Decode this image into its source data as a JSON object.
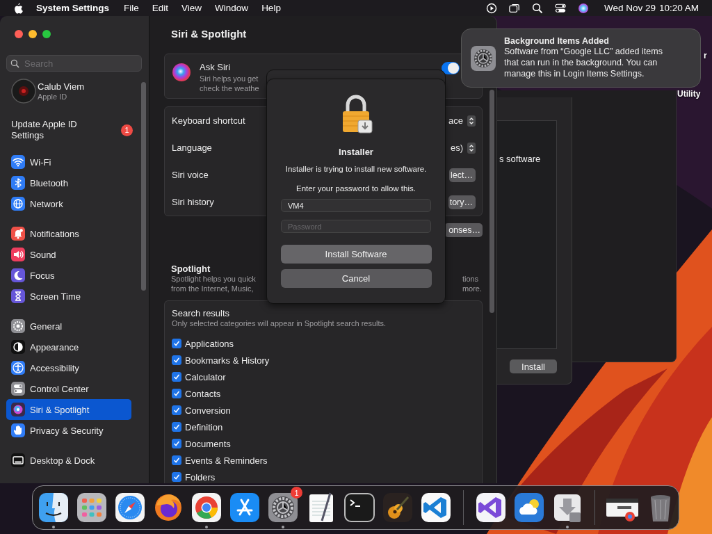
{
  "menu_bar": {
    "app_name": "System Settings",
    "menus": [
      "File",
      "Edit",
      "View",
      "Window",
      "Help"
    ],
    "date": "Wed Nov 29",
    "time": "10:20 AM"
  },
  "settings_window": {
    "sidebar": {
      "search": {
        "placeholder": "Search"
      },
      "account": {
        "name": "Calub Viem",
        "subtitle": "Apple ID"
      },
      "update": {
        "label": "Update Apple ID Settings",
        "badge": "1"
      },
      "groups": [
        [
          {
            "label": "Wi-Fi",
            "kind": "wifi",
            "color": "#2f7cf6",
            "selected": false
          },
          {
            "label": "Bluetooth",
            "kind": "bluetooth",
            "color": "#2f7cf6",
            "selected": false
          },
          {
            "label": "Network",
            "kind": "network",
            "color": "#2f7cf6",
            "selected": false
          }
        ],
        [
          {
            "label": "Notifications",
            "kind": "notifications",
            "color": "#ef5148",
            "selected": false
          },
          {
            "label": "Sound",
            "kind": "sound",
            "color": "#ee3e5e",
            "selected": false
          },
          {
            "label": "Focus",
            "kind": "focus",
            "color": "#6656d8",
            "selected": false
          },
          {
            "label": "Screen Time",
            "kind": "screen_time",
            "color": "#6656d8",
            "selected": false
          }
        ],
        [
          {
            "label": "General",
            "kind": "general",
            "color": "#8e8e93",
            "selected": false
          },
          {
            "label": "Appearance",
            "kind": "appearance",
            "color": "#111111",
            "selected": false
          },
          {
            "label": "Accessibility",
            "kind": "accessibility",
            "color": "#2f7cf6",
            "selected": false
          },
          {
            "label": "Control Center",
            "kind": "control_center",
            "color": "#8e8e93",
            "selected": false
          },
          {
            "label": "Siri & Spotlight",
            "kind": "siri",
            "color": "#3a2a4a",
            "selected": true
          },
          {
            "label": "Privacy & Security",
            "kind": "privacy",
            "color": "#2f7cf6",
            "selected": false
          }
        ],
        [
          {
            "label": "Desktop & Dock",
            "kind": "desktop",
            "color": "#111111",
            "selected": false
          }
        ]
      ]
    },
    "title": "Siri & Spotlight",
    "ask_siri": {
      "title": "Ask Siri",
      "description_lines": [
        "Siri helps you get",
        "check the weathe"
      ],
      "on": true
    },
    "rows": [
      {
        "label": "Keyboard shortcut",
        "kind": "popup",
        "value": "ace"
      },
      {
        "label": "Language",
        "kind": "popup",
        "value": "es)"
      },
      {
        "label": "Siri voice",
        "kind": "button",
        "value": "lect…"
      },
      {
        "label": "Siri history",
        "kind": "button",
        "value": "tory…"
      }
    ],
    "responses_button": "onses…",
    "spotlight": {
      "title": "Spotlight",
      "description_left": [
        "Spotlight helps you quick",
        "from the Internet, Music,"
      ],
      "description_right": [
        "tions",
        "more."
      ]
    },
    "search_results": {
      "title": "Search results",
      "description": "Only selected categories will appear in Spotlight search results.",
      "categories": [
        {
          "label": "Applications",
          "checked": true
        },
        {
          "label": "Bookmarks & History",
          "checked": true
        },
        {
          "label": "Calculator",
          "checked": true
        },
        {
          "label": "Contacts",
          "checked": true
        },
        {
          "label": "Conversion",
          "checked": true
        },
        {
          "label": "Definition",
          "checked": true
        },
        {
          "label": "Documents",
          "checked": true
        },
        {
          "label": "Events & Reminders",
          "checked": true
        },
        {
          "label": "Folders",
          "checked": true
        }
      ]
    }
  },
  "installer_dialog": {
    "title": "Installer",
    "message": "Installer is trying to install new software.",
    "prompt": "Enter your password to allow this.",
    "username": "VM4",
    "password_placeholder": "Password",
    "buttons": [
      {
        "label": "Install Software",
        "kind": "default"
      },
      {
        "label": "Cancel",
        "kind": "cancel"
      }
    ]
  },
  "installer_window": {
    "text": "s software",
    "button": "Install"
  },
  "desktop_label": [
    "r",
    "Utility"
  ],
  "notification": {
    "title": "Background Items Added",
    "body": "Software from “Google LLC” added items that can run in the background. You can manage this in Login Items Settings."
  },
  "dock": {
    "sections": [
      [
        {
          "kind": "finder",
          "running": true
        },
        {
          "kind": "launchpad",
          "running": false
        },
        {
          "kind": "safari",
          "running": false
        },
        {
          "kind": "firefox",
          "running": false
        },
        {
          "kind": "chrome",
          "running": true
        },
        {
          "kind": "app_store",
          "running": false
        },
        {
          "kind": "settings",
          "running": true,
          "badge": "1"
        },
        {
          "kind": "textedit",
          "running": false
        },
        {
          "kind": "terminal",
          "running": false
        },
        {
          "kind": "garageband",
          "running": false
        },
        {
          "kind": "vscode",
          "running": false
        }
      ],
      [
        {
          "kind": "visual_studio",
          "running": false
        },
        {
          "kind": "weather",
          "running": false
        },
        {
          "kind": "installer",
          "running": true
        }
      ],
      [
        {
          "kind": "window",
          "running": false
        },
        {
          "kind": "trash",
          "running": false
        }
      ]
    ]
  }
}
